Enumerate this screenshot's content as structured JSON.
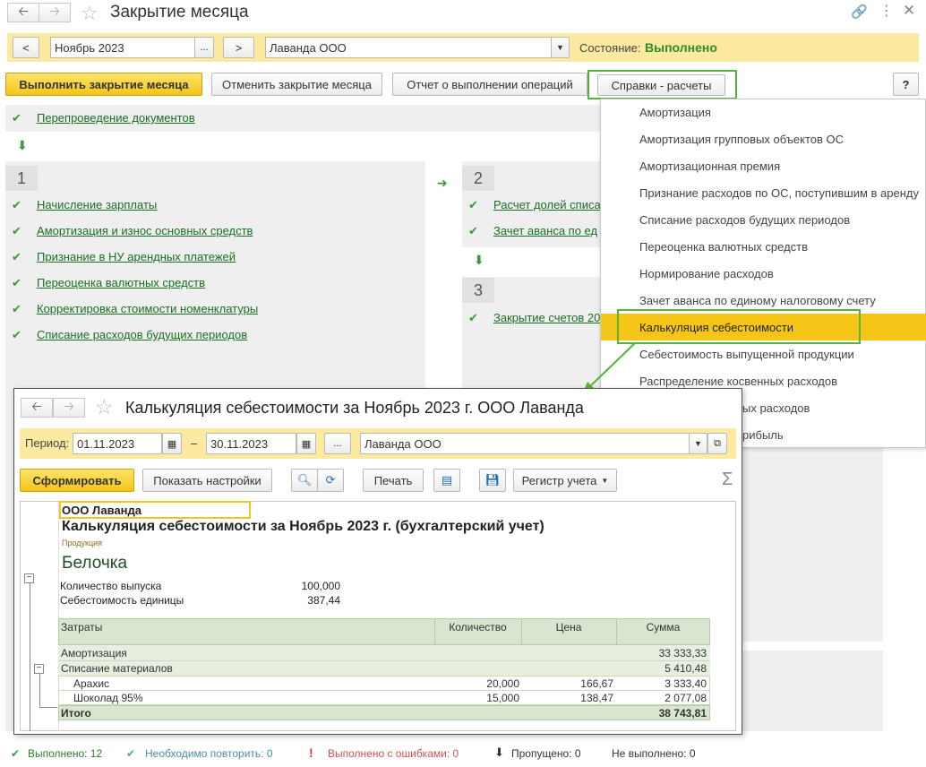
{
  "main": {
    "title": "Закрытие месяца",
    "period": "Ноябрь 2023",
    "organization": "Лаванда ООО",
    "status_label": "Состояние:",
    "status_value": "Выполнено",
    "buttons": {
      "prev": "<",
      "next": ">",
      "period_select": "...",
      "execute": "Выполнить закрытие месяца",
      "cancel": "Отменить закрытие месяца",
      "report": "Отчет о выполнении операций",
      "refs": "Справки - расчеты",
      "help": "?"
    },
    "repost": "Перепроведение документов",
    "stage1": {
      "number": "1",
      "items": [
        "Начисление зарплаты",
        "Амортизация и износ основных средств",
        "Признание в НУ арендных платежей",
        "Переоценка валютных средств",
        "Корректировка стоимости номенклатуры",
        "Списание расходов будущих периодов"
      ]
    },
    "stage2": {
      "number": "2",
      "items": [
        "Расчет долей списа",
        "Зачет аванса по ед"
      ]
    },
    "stage3": {
      "number": "3",
      "items": [
        "Закрытие счетов 20"
      ]
    }
  },
  "menu": {
    "items": [
      "Амортизация",
      "Амортизация групповых объектов ОС",
      "Амортизационная премия",
      "Признание расходов по ОС, поступившим в аренду",
      "Списание расходов будущих периодов",
      "Переоценка валютных средств",
      "Нормирование расходов",
      "Зачет аванса по единому налоговому счету",
      "Калькуляция себестоимости",
      "Себестоимость выпущенной продукции",
      "Распределение косвенных расходов",
      "ых расходов",
      "рибыль"
    ]
  },
  "report": {
    "title": "Калькуляция себестоимости за Ноябрь 2023 г. ООО Лаванда",
    "period_label": "Период:",
    "date_from": "01.11.2023",
    "dash": "–",
    "date_to": "30.11.2023",
    "ellipsis": "...",
    "organization": "Лаванда ООО",
    "buttons": {
      "generate": "Сформировать",
      "settings": "Показать настройки",
      "print": "Печать",
      "register": "Регистр учета"
    },
    "sigma": "Σ",
    "org_header": "ООО Лаванда",
    "heading": "Калькуляция себестоимости за Ноябрь 2023 г. (бухгалтерский учет)",
    "product_label": "Продукция",
    "product_name": "Белочка",
    "output_label": "Количество выпуска",
    "output_value": "100,000",
    "unit_cost_label": "Себестоимость единицы",
    "unit_cost_value": "387,44",
    "table": {
      "headers": [
        "Затраты",
        "Количество",
        "Цена",
        "Сумма"
      ],
      "rows": [
        {
          "name": "Амортизация",
          "qty": "",
          "price": "",
          "sum": "33 333,33"
        },
        {
          "name": "Списание материалов",
          "qty": "",
          "price": "",
          "sum": "5 410,48"
        },
        {
          "name": "Арахис",
          "qty": "20,000",
          "price": "166,67",
          "sum": "3 333,40"
        },
        {
          "name": "Шоколад 95%",
          "qty": "15,000",
          "price": "138,47",
          "sum": "2 077,08"
        }
      ],
      "total": {
        "name": "Итого",
        "sum": "38 743,81"
      }
    }
  },
  "statusbar": {
    "done": "Выполнено: 12",
    "repeat": "Необходимо повторить: 0",
    "errors": "Выполнено с ошибками: 0",
    "skipped": "Пропущено: 0",
    "not_done": "Не выполнено: 0"
  },
  "colors": {
    "accent_yellow": "#f5c518",
    "highlight_green": "#55b33b",
    "link_green": "#1a6e22",
    "table_header": "#d8e6cf"
  }
}
